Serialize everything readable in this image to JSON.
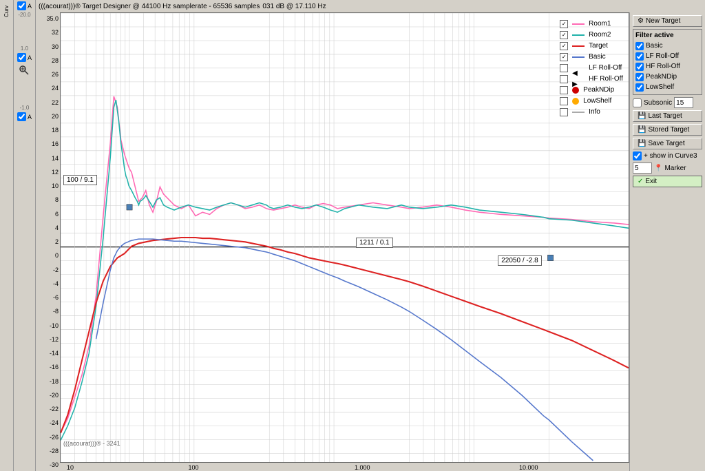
{
  "title": "(((acourat)))® Target Designer @ 44100 Hz samplerate - 65536 samples",
  "subtitle": "031 dB @ 17.110 Hz",
  "watermark": "(((acourat)))® - 3241",
  "yaxis": {
    "labels": [
      "35.0",
      "32",
      "30",
      "28",
      "26",
      "24",
      "22",
      "20",
      "18",
      "16",
      "14",
      "12",
      "10",
      "8",
      "6",
      "4",
      "2",
      "0",
      "-2",
      "-4",
      "-6",
      "-8",
      "-10",
      "-12",
      "-14",
      "-16",
      "-18",
      "-20",
      "-22",
      "-24",
      "-26",
      "-28",
      "-30"
    ]
  },
  "xaxis": {
    "labels": [
      "10",
      "100",
      "1.000",
      "10.000"
    ]
  },
  "left_axis_values": [
    "-20.0",
    "1.0",
    "-1.0"
  ],
  "tooltips": [
    {
      "label": "100 / 9.1",
      "x_pct": 12.5,
      "y_pct": 40
    },
    {
      "label": "1211 / 0.1",
      "x_pct": 54,
      "y_pct": 62
    },
    {
      "label": "22050 / -2.8",
      "x_pct": 82,
      "y_pct": 67
    }
  ],
  "legend": {
    "items": [
      {
        "label": "Room1",
        "color": "#ff69b4",
        "checked": true
      },
      {
        "label": "Room2",
        "color": "#40a0a0",
        "checked": true
      },
      {
        "label": "Target",
        "color": "#ff4444",
        "checked": true
      },
      {
        "label": "Basic",
        "color": "#4466cc",
        "checked": true
      },
      {
        "label": "LF Roll-Off",
        "color": "#888",
        "checked": false,
        "triangle_left": true
      },
      {
        "label": "HF Roll-Off",
        "color": "#888",
        "checked": false,
        "triangle_right": true
      },
      {
        "label": "PeakNDip",
        "color": "#cc0000",
        "checked": false,
        "dot": true
      },
      {
        "label": "LowShelf",
        "color": "#ffaa00",
        "checked": false,
        "circle": true
      },
      {
        "label": "Info",
        "color": "#aaa",
        "checked": false
      }
    ]
  },
  "filter_active": {
    "title": "Filter active",
    "items": [
      {
        "label": "Basic",
        "checked": true
      },
      {
        "label": "LF Roll-Off",
        "checked": true
      },
      {
        "label": "HF Roll-Off",
        "checked": true
      },
      {
        "label": "PeakNDip",
        "checked": true
      },
      {
        "label": "LowShelf",
        "checked": true
      }
    ]
  },
  "buttons": {
    "new_target": "New Target",
    "subsonic_label": "Subsonic",
    "subsonic_value": "15",
    "last_target": "Last Target",
    "stored_target": "Stored Target",
    "save_target": "Save Target",
    "show_curve3": "+ show in Curve3",
    "marker_label": "Marker",
    "marker_value": "5",
    "exit": "Exit"
  },
  "colors": {
    "room1": "#ff69b4",
    "room2": "#20b2aa",
    "target": "#ff4444",
    "basic": "#6688dd",
    "background": "#d4d0c8",
    "chart_bg": "#ffffff"
  }
}
